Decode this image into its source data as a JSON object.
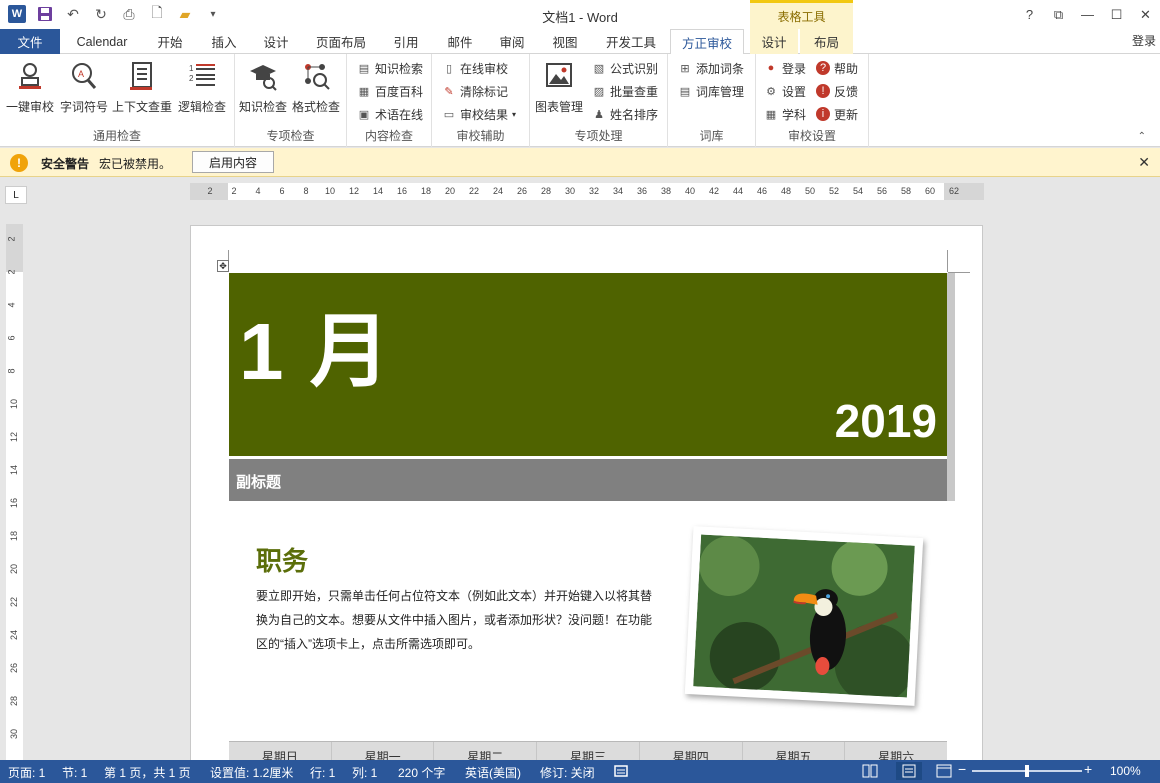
{
  "app": {
    "title": "文档1 - Word",
    "context_tool": "表格工具",
    "login": "登录"
  },
  "window_controls": [
    "?",
    "⧉",
    "—",
    "☐",
    "✕"
  ],
  "tabs": [
    {
      "label": "文件"
    },
    {
      "label": "Calendar"
    },
    {
      "label": "开始"
    },
    {
      "label": "插入"
    },
    {
      "label": "设计"
    },
    {
      "label": "页面布局"
    },
    {
      "label": "引用"
    },
    {
      "label": "邮件"
    },
    {
      "label": "审阅"
    },
    {
      "label": "视图"
    },
    {
      "label": "开发工具"
    },
    {
      "label": "方正审校"
    },
    {
      "label": "设计"
    },
    {
      "label": "布局"
    }
  ],
  "ribbon": {
    "general": {
      "label": "通用检查",
      "buttons": [
        "一键审校",
        "字词符号",
        "上下文查重",
        "逻辑检查"
      ]
    },
    "special": {
      "label": "专项检查",
      "buttons": [
        "知识检查",
        "格式检查"
      ]
    },
    "content": {
      "label": "内容检查",
      "buttons": [
        "知识检索",
        "百度百科",
        "术语在线"
      ]
    },
    "assist": {
      "label": "审校辅助",
      "buttons": [
        "在线审校",
        "清除标记",
        "审校结果"
      ]
    },
    "process": {
      "label": "专项处理",
      "big": "图表管理",
      "buttons": [
        "公式识别",
        "批量查重",
        "姓名排序"
      ]
    },
    "lexicon": {
      "label": "词库",
      "buttons": [
        "添加词条",
        "词库管理"
      ]
    },
    "settings": {
      "label": "审校设置",
      "col1": [
        "登录",
        "设置",
        "学科"
      ],
      "col2": [
        "帮助",
        "反馈",
        "更新"
      ]
    }
  },
  "security_bar": {
    "title": "安全警告",
    "message": "宏已被禁用。",
    "button": "启用内容"
  },
  "ruler": {
    "h_numbers": [
      "2",
      "2",
      "4",
      "6",
      "8",
      "10",
      "12",
      "14",
      "16",
      "18",
      "20",
      "22",
      "24",
      "26",
      "28",
      "30",
      "32",
      "34",
      "36",
      "38",
      "40",
      "42",
      "44",
      "46",
      "48",
      "50",
      "52",
      "54",
      "56",
      "58",
      "60",
      "62"
    ],
    "v_numbers": [
      "2",
      "2",
      "4",
      "6",
      "8",
      "10",
      "12",
      "14",
      "16",
      "18",
      "20",
      "22",
      "24",
      "26",
      "28",
      "30"
    ]
  },
  "document": {
    "month": "1 月",
    "year": "2019",
    "subtitle": "副标题",
    "heading": "职务",
    "body": "要立即开始，只需单击任何占位符文本（例如此文本）并开始键入以将其替换为自己的文本。想要从文件中插入图片，或者添加形状？没问题！在功能区的“插入”选项卡上，点击所需选项即可。",
    "weekdays": [
      "星期日",
      "星期一",
      "星期二",
      "星期三",
      "星期四",
      "星期五",
      "星期六"
    ]
  },
  "colors": {
    "brand": "#2b579a",
    "banner": "#4f6300",
    "subbar": "#808080",
    "heading": "#5b6e0a"
  },
  "status": {
    "page": "页面: 1",
    "section": "节: 1",
    "pages": "第 1 页，共 1 页",
    "setting": "设置值: 1.2厘米",
    "row": "行: 1",
    "col": "列: 1",
    "words": "220 个字",
    "lang": "英语(美国)",
    "track": "修订: 关闭",
    "zoom": "100%",
    "zoom_level": 0.5
  }
}
